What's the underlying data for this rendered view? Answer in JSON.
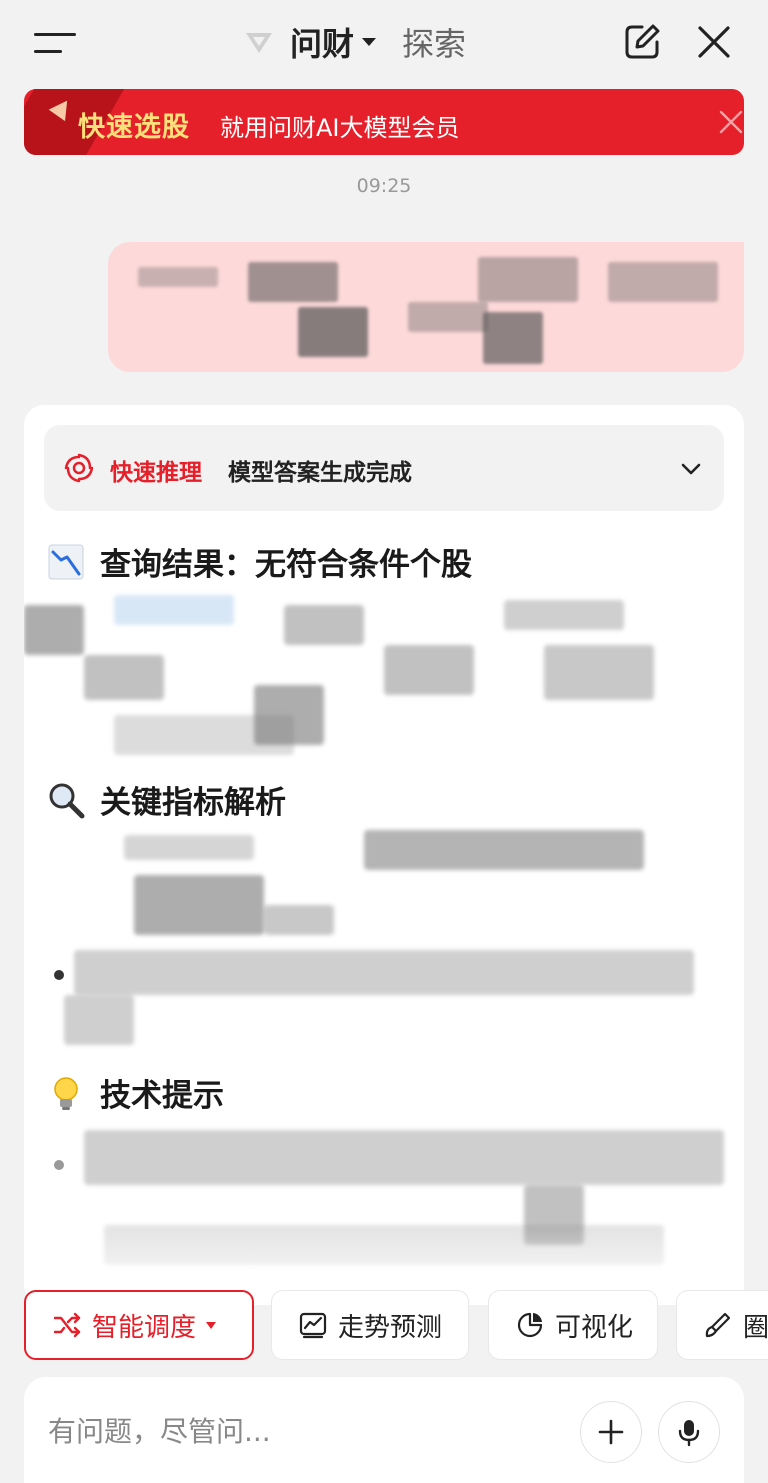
{
  "header": {
    "title": "问财",
    "explore": "探索"
  },
  "promo": {
    "tag": "快速选股",
    "text": "就用问财AI大模型会员"
  },
  "chat": {
    "timestamp": "09:25",
    "status": {
      "label": "快速推理",
      "text": "模型答案生成完成"
    },
    "sections": [
      {
        "icon": "chart-down-icon",
        "title": "查询结果：无符合条件个股"
      },
      {
        "icon": "magnifier-icon",
        "title": "关键指标解析"
      },
      {
        "icon": "lightbulb-icon",
        "title": "技术提示"
      }
    ]
  },
  "chips": [
    {
      "label": "智能调度",
      "icon": "shuffle-icon",
      "active": true
    },
    {
      "label": "走势预测",
      "icon": "trend-chart-icon",
      "active": false
    },
    {
      "label": "可视化",
      "icon": "pie-chart-icon",
      "active": false
    },
    {
      "label": "圈",
      "icon": "brush-icon",
      "active": false
    }
  ],
  "input": {
    "placeholder": "有问题，尽管问..."
  },
  "colors": {
    "brand_red": "#e5202a",
    "promo_tag": "#ffe07a",
    "user_bubble": "#fdd9d9",
    "background": "#f2f2f2"
  }
}
